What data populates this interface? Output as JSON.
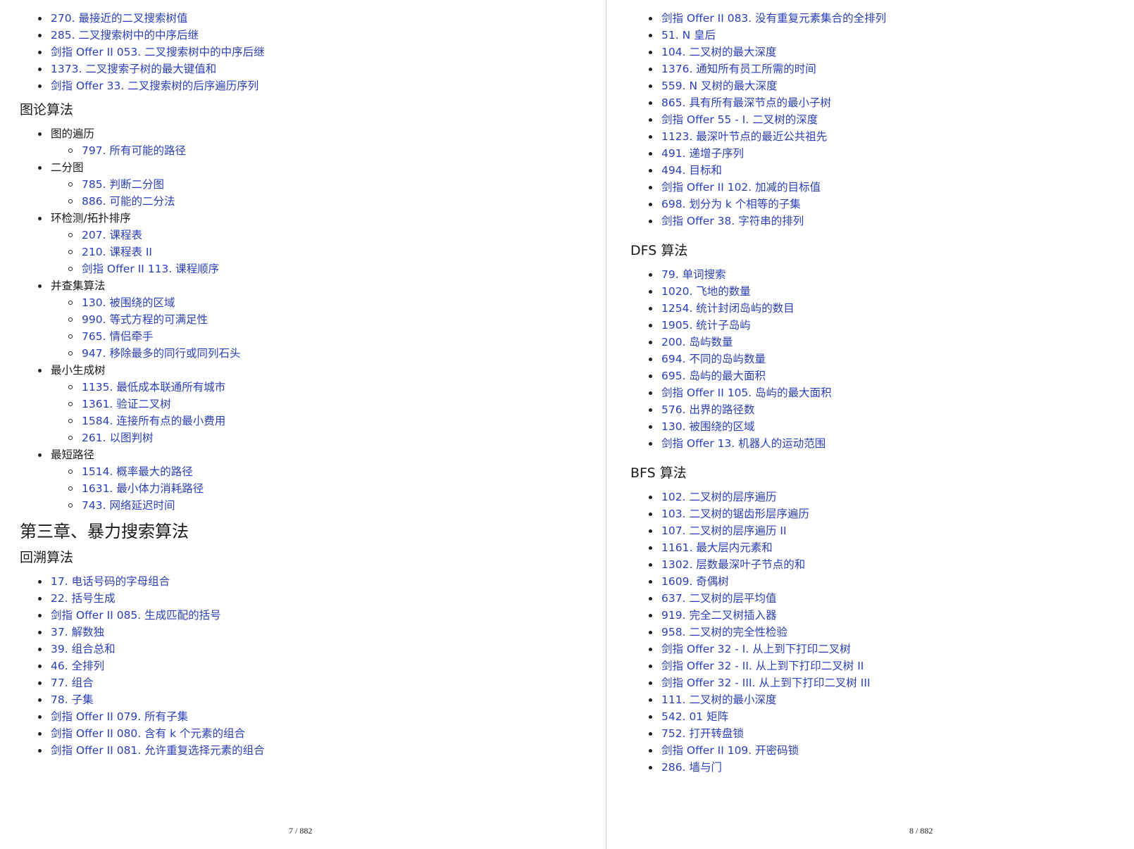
{
  "left": {
    "top_items": [
      "270. 最接近的二叉搜索树值",
      "285. 二叉搜索树中的中序后继",
      "剑指 Offer II 053. 二叉搜索树中的中序后继",
      "1373. 二叉搜索子树的最大键值和",
      "剑指 Offer 33. 二叉搜索树的后序遍历序列"
    ],
    "graph_heading": "图论算法",
    "graph_groups": [
      {
        "label": "图的遍历",
        "items": [
          "797. 所有可能的路径"
        ]
      },
      {
        "label": "二分图",
        "items": [
          "785. 判断二分图",
          "886. 可能的二分法"
        ]
      },
      {
        "label": "环检测/拓扑排序",
        "items": [
          "207. 课程表",
          "210. 课程表 II",
          "剑指 Offer II 113. 课程顺序"
        ]
      },
      {
        "label": "并查集算法",
        "items": [
          "130. 被围绕的区域",
          "990. 等式方程的可满足性",
          "765. 情侣牵手",
          "947. 移除最多的同行或同列石头"
        ]
      },
      {
        "label": "最小生成树",
        "items": [
          "1135. 最低成本联通所有城市",
          "1361. 验证二叉树",
          "1584. 连接所有点的最小费用",
          "261. 以图判树"
        ]
      },
      {
        "label": "最短路径",
        "items": [
          "1514. 概率最大的路径",
          "1631. 最小体力消耗路径",
          "743. 网络延迟时间"
        ]
      }
    ],
    "chapter_heading": "第三章、暴力搜索算法",
    "backtrack_heading": "回溯算法",
    "backtrack_items": [
      "17. 电话号码的字母组合",
      "22. 括号生成",
      "剑指 Offer II 085. 生成匹配的括号",
      "37. 解数独",
      "39. 组合总和",
      "46. 全排列",
      "77. 组合",
      "78. 子集",
      "剑指 Offer II 079. 所有子集",
      "剑指 Offer II 080. 含有 k 个元素的组合",
      "剑指 Offer II 081. 允许重复选择元素的组合"
    ],
    "page_number": "7 / 882"
  },
  "right": {
    "top_items": [
      "剑指 Offer II 083. 没有重复元素集合的全排列",
      "51. N 皇后",
      "104. 二叉树的最大深度",
      "1376. 通知所有员工所需的时间",
      "559. N 叉树的最大深度",
      "865. 具有所有最深节点的最小子树",
      "剑指 Offer 55 - I. 二叉树的深度",
      "1123. 最深叶节点的最近公共祖先",
      "491. 递增子序列",
      "494. 目标和",
      "剑指 Offer II 102. 加减的目标值",
      "698. 划分为 k 个相等的子集",
      "剑指 Offer 38. 字符串的排列"
    ],
    "dfs_heading": "DFS 算法",
    "dfs_items": [
      "79. 单词搜索",
      "1020. 飞地的数量",
      "1254. 统计封闭岛屿的数目",
      "1905. 统计子岛屿",
      "200. 岛屿数量",
      "694. 不同的岛屿数量",
      "695. 岛屿的最大面积",
      "剑指 Offer II 105. 岛屿的最大面积",
      "576. 出界的路径数",
      "130. 被围绕的区域",
      "剑指 Offer 13. 机器人的运动范围"
    ],
    "bfs_heading": "BFS 算法",
    "bfs_items": [
      "102. 二叉树的层序遍历",
      "103. 二叉树的锯齿形层序遍历",
      "107. 二叉树的层序遍历 II",
      "1161. 最大层内元素和",
      "1302. 层数最深叶子节点的和",
      "1609. 奇偶树",
      "637. 二叉树的层平均值",
      "919. 完全二叉树插入器",
      "958. 二叉树的完全性检验",
      "剑指 Offer 32 - I. 从上到下打印二叉树",
      "剑指 Offer 32 - II. 从上到下打印二叉树 II",
      "剑指 Offer 32 - III. 从上到下打印二叉树 III",
      "111. 二叉树的最小深度",
      "542. 01 矩阵",
      "752. 打开转盘锁",
      "剑指 Offer II 109. 开密码锁",
      "286. 墙与门"
    ],
    "page_number": "8 / 882"
  }
}
